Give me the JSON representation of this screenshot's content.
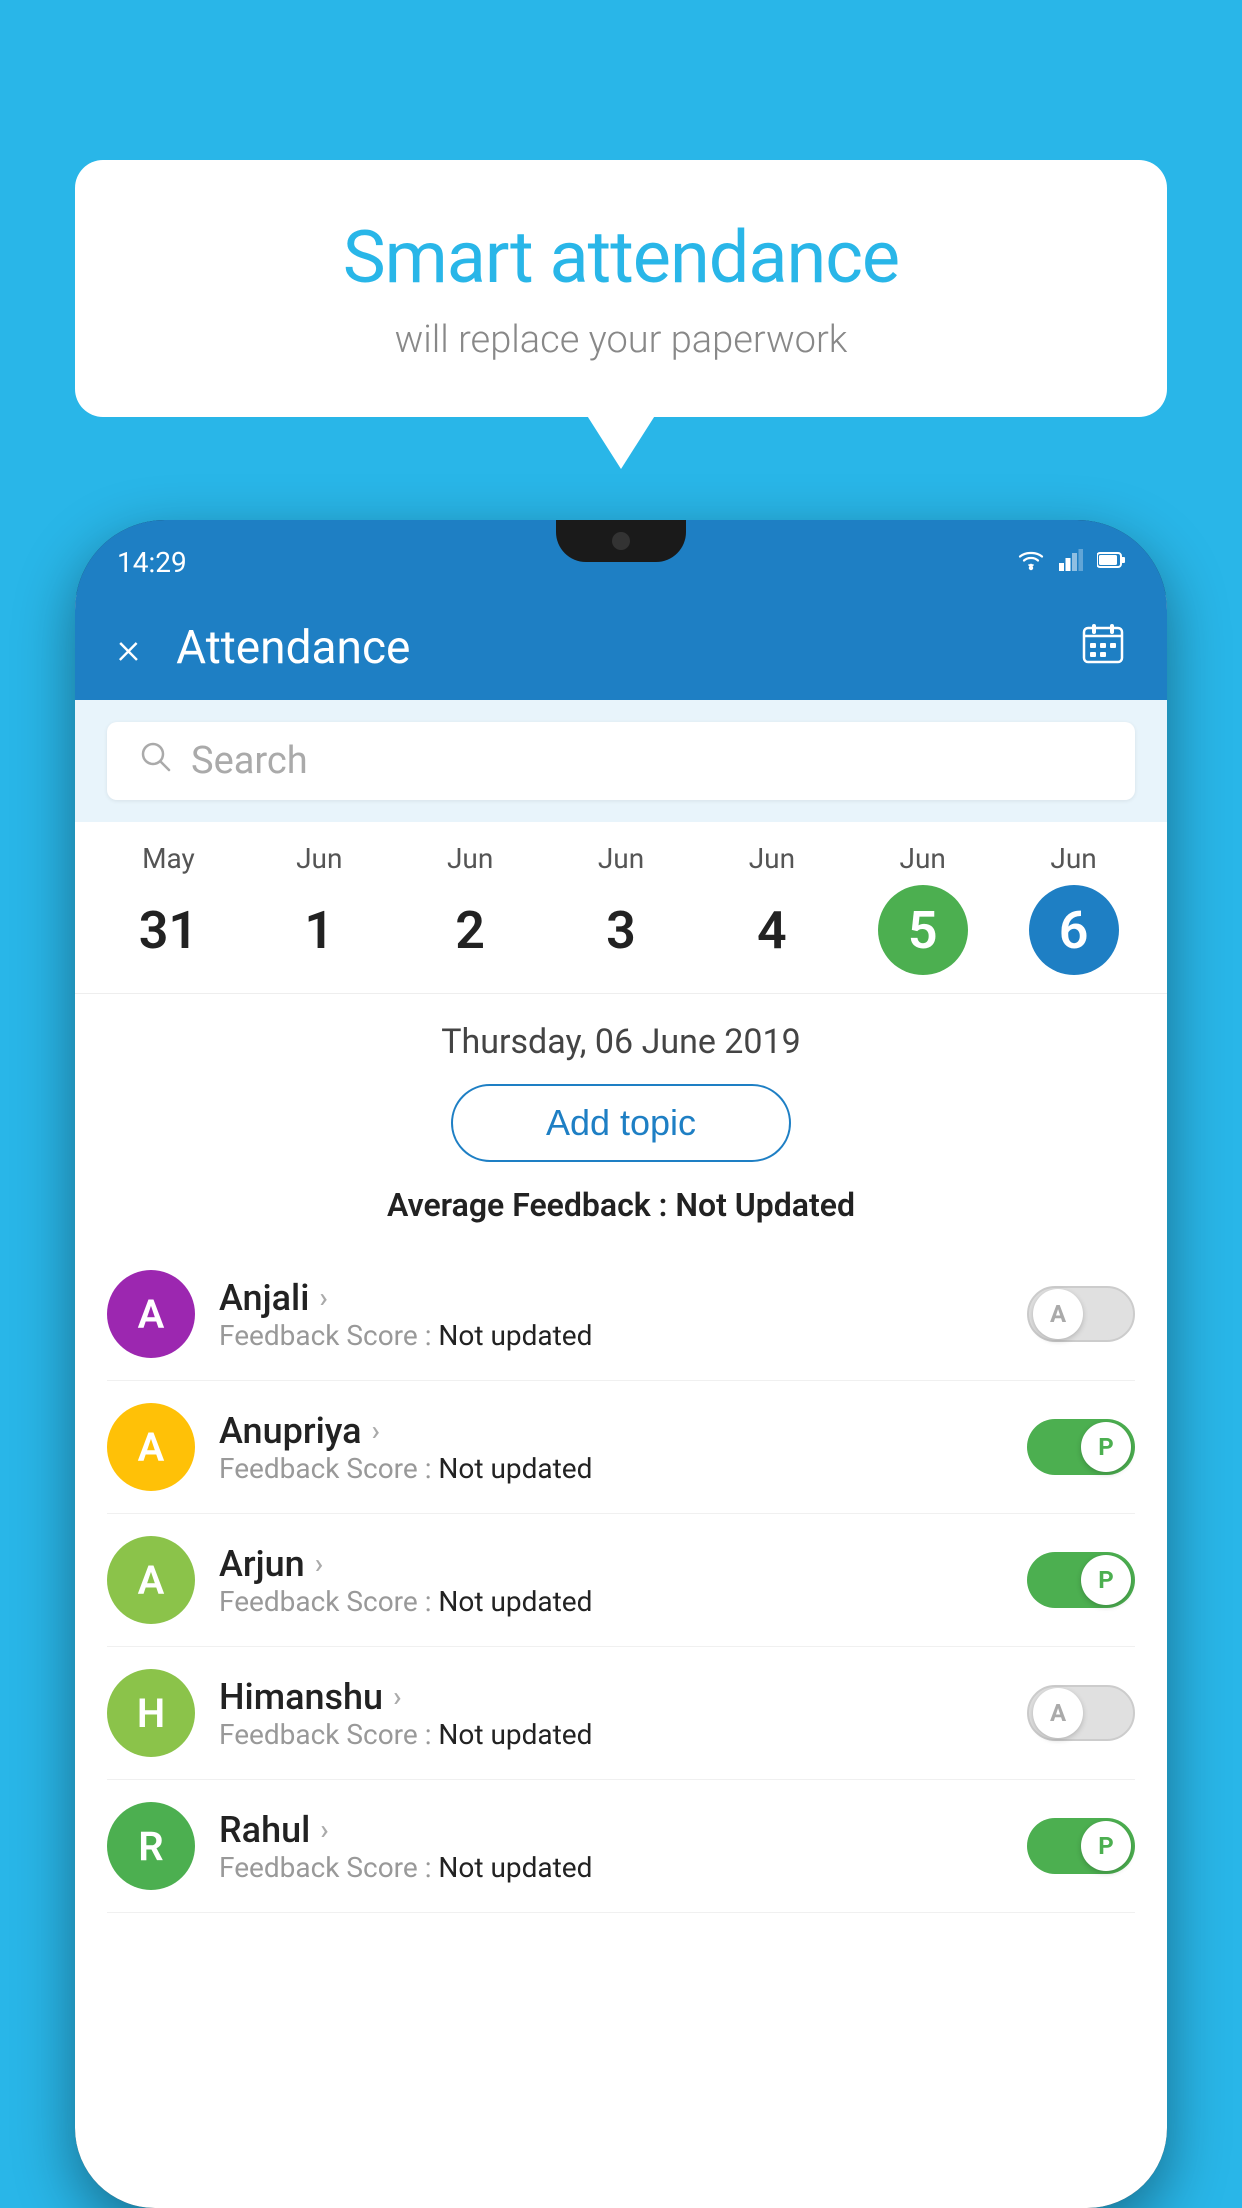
{
  "background_color": "#29b6e8",
  "speech_bubble": {
    "title": "Smart attendance",
    "subtitle": "will replace your paperwork"
  },
  "phone": {
    "status_bar": {
      "time": "14:29",
      "icons": [
        "wifi",
        "signal",
        "battery"
      ]
    },
    "header": {
      "title": "Attendance",
      "close_label": "×",
      "calendar_icon": "📅"
    },
    "search": {
      "placeholder": "Search"
    },
    "calendar": {
      "days": [
        {
          "month": "May",
          "date": "31",
          "selected": false
        },
        {
          "month": "Jun",
          "date": "1",
          "selected": false
        },
        {
          "month": "Jun",
          "date": "2",
          "selected": false
        },
        {
          "month": "Jun",
          "date": "3",
          "selected": false
        },
        {
          "month": "Jun",
          "date": "4",
          "selected": false
        },
        {
          "month": "Jun",
          "date": "5",
          "selected": "green"
        },
        {
          "month": "Jun",
          "date": "6",
          "selected": "blue"
        }
      ]
    },
    "selected_date": "Thursday, 06 June 2019",
    "add_topic_label": "Add topic",
    "average_feedback_label": "Average Feedback :",
    "average_feedback_value": "Not Updated",
    "students": [
      {
        "name": "Anjali",
        "initial": "A",
        "avatar_color": "#9c27b0",
        "feedback_label": "Feedback Score :",
        "feedback_value": "Not updated",
        "toggle": "off",
        "toggle_letter": "A"
      },
      {
        "name": "Anupriya",
        "initial": "A",
        "avatar_color": "#ffc107",
        "feedback_label": "Feedback Score :",
        "feedback_value": "Not updated",
        "toggle": "on",
        "toggle_letter": "P"
      },
      {
        "name": "Arjun",
        "initial": "A",
        "avatar_color": "#8bc34a",
        "feedback_label": "Feedback Score :",
        "feedback_value": "Not updated",
        "toggle": "on",
        "toggle_letter": "P"
      },
      {
        "name": "Himanshu",
        "initial": "H",
        "avatar_color": "#8bc34a",
        "feedback_label": "Feedback Score :",
        "feedback_value": "Not updated",
        "toggle": "off",
        "toggle_letter": "A"
      },
      {
        "name": "Rahul",
        "initial": "R",
        "avatar_color": "#4caf50",
        "feedback_label": "Feedback Score :",
        "feedback_value": "Not updated",
        "toggle": "on",
        "toggle_letter": "P"
      }
    ]
  }
}
